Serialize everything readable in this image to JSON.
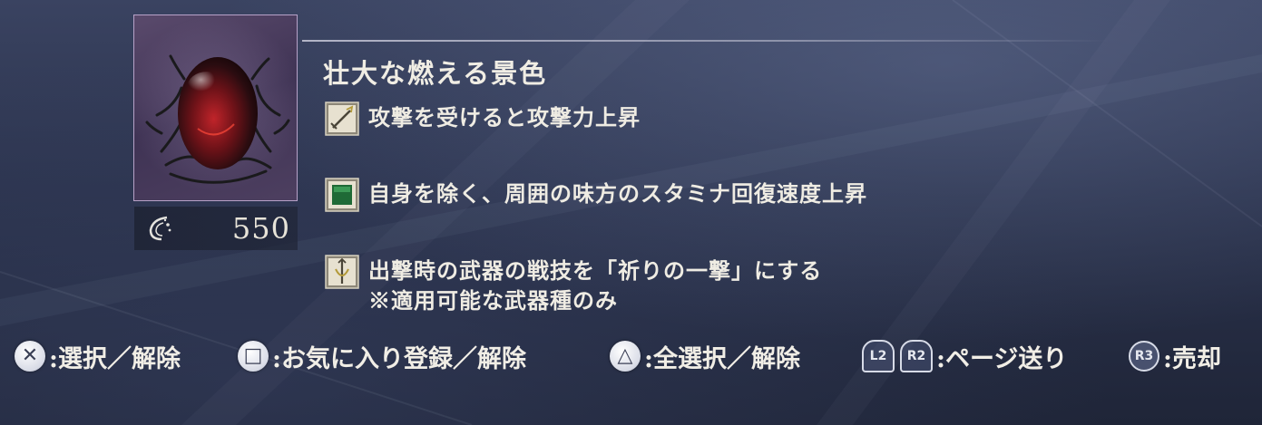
{
  "item": {
    "title": "壮大な燃える景色",
    "rune_value": "550",
    "image_name": "burning-vista-relic"
  },
  "effects": [
    {
      "icon": "sword-attack-icon",
      "text": "攻撃を受けると攻撃力上昇",
      "note": ""
    },
    {
      "icon": "green-stamina-icon",
      "text": "自身を除く、周囲の味方のスタミナ回復速度上昇",
      "note": ""
    },
    {
      "icon": "weapon-skill-icon",
      "text": "出撃時の武器の戦技を「祈りの一撃」にする",
      "note": "※適用可能な武器種のみ"
    }
  ],
  "controls": {
    "cross": {
      "glyph": "✕",
      "label": ":選択／解除"
    },
    "square": {
      "glyph": "□",
      "label": ":お気に入り登録／解除"
    },
    "triangle": {
      "glyph": "△",
      "label": ":全選択／解除"
    },
    "l2": "L2",
    "r2": "R2",
    "page": {
      "label": ":ページ送り"
    },
    "r3": {
      "glyph": "R3",
      "label": ":売却"
    }
  },
  "colors": {
    "background": "#2b334d",
    "frame_border": "#b7a2c8",
    "text": "#efece3"
  }
}
